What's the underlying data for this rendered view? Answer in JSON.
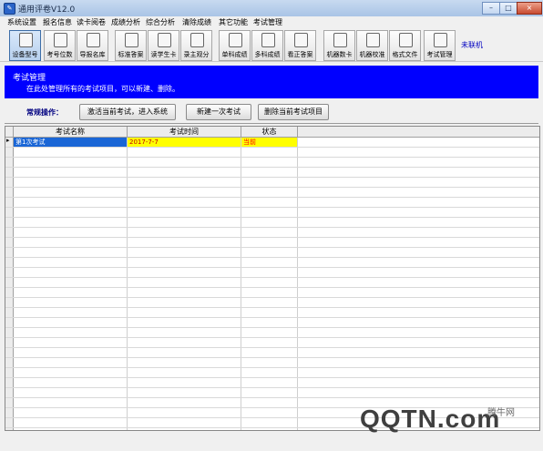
{
  "window": {
    "title": "通用评卷V12.0",
    "minimize": "–",
    "maximize": "□",
    "close": "×"
  },
  "menu": [
    "系统设置",
    "报名信息",
    "读卡阅卷",
    "成绩分析",
    "综合分析",
    "清除成绩",
    "其它功能",
    "考试管理"
  ],
  "toolbar": {
    "buttons": [
      {
        "label": "设备型号",
        "icon": "device-icon"
      },
      {
        "label": "考号位数",
        "icon": "digits-icon"
      },
      {
        "label": "导报名库",
        "icon": "import-icon"
      },
      {
        "label": "标准答案",
        "icon": "answer-key-icon"
      },
      {
        "label": "读学生卡",
        "icon": "read-card-icon"
      },
      {
        "label": "录主观分",
        "icon": "subjective-score-icon"
      },
      {
        "label": "单科成绩",
        "icon": "single-subject-icon"
      },
      {
        "label": "多科成绩",
        "icon": "multi-subject-icon"
      },
      {
        "label": "看正答案",
        "icon": "view-answer-icon"
      },
      {
        "label": "机器数卡",
        "icon": "machine-count-icon"
      },
      {
        "label": "机器校准",
        "icon": "calibrate-icon"
      },
      {
        "label": "格式文件",
        "icon": "format-file-icon"
      },
      {
        "label": "考试管理",
        "icon": "exam-manage-icon"
      }
    ],
    "status": "未联机"
  },
  "banner": {
    "title": "考试管理",
    "description": "在此处管理所有的考试项目，可以新建、删除。"
  },
  "ops": {
    "label": "常规操作：",
    "activate": "激活当前考试，进入系统",
    "new_exam": "新建一次考试",
    "delete": "删除当前考试项目"
  },
  "table": {
    "headers": [
      "考试名称",
      "考试时间",
      "状态"
    ],
    "rows": [
      {
        "name": "第1次考试",
        "date": "2017-7-7",
        "status": "当前"
      }
    ],
    "empty_rows": 29
  },
  "watermark": {
    "logo": "QQTN.com",
    "caption": "腾牛网"
  },
  "colors": {
    "banner": "#0000ff",
    "selected_name": "#1a66d6",
    "selected_date": "#ffff00",
    "status_text": "#ff0000"
  }
}
